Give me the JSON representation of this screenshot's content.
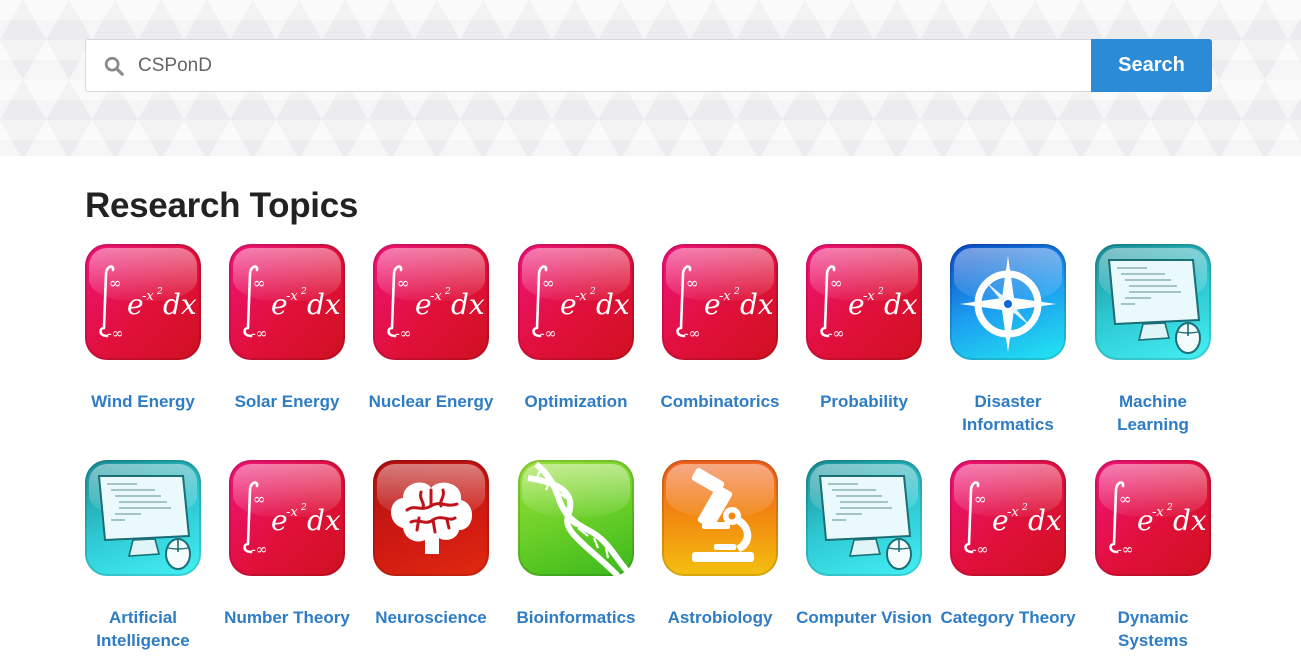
{
  "search": {
    "value": "",
    "placeholder": "CSPonD",
    "button_label": "Search",
    "icon": "search-icon"
  },
  "section_title": "Research Topics",
  "topics": [
    {
      "label": "Wind Energy",
      "icon": "math-integral-icon"
    },
    {
      "label": "Solar Energy",
      "icon": "math-integral-icon"
    },
    {
      "label": "Nuclear Energy",
      "icon": "math-integral-icon"
    },
    {
      "label": "Optimization",
      "icon": "math-integral-icon"
    },
    {
      "label": "Combinatorics",
      "icon": "math-integral-icon"
    },
    {
      "label": "Probability",
      "icon": "math-integral-icon"
    },
    {
      "label": "Disaster Informatics",
      "icon": "compass-icon"
    },
    {
      "label": "Machine Learning",
      "icon": "computer-icon"
    },
    {
      "label": "Artificial Intelligence",
      "icon": "computer-icon"
    },
    {
      "label": "Number Theory",
      "icon": "math-integral-icon"
    },
    {
      "label": "Neuroscience",
      "icon": "brain-icon"
    },
    {
      "label": "Bioinformatics",
      "icon": "dna-icon"
    },
    {
      "label": "Astrobiology",
      "icon": "microscope-icon"
    },
    {
      "label": "Computer Vision",
      "icon": "computer-icon"
    },
    {
      "label": "Category Theory",
      "icon": "math-integral-icon"
    },
    {
      "label": "Dynamic Systems",
      "icon": "math-integral-icon"
    }
  ],
  "colors": {
    "link": "#2e7cc4",
    "search_button": "#2b8bd6",
    "math_tile": "#e0103a",
    "compass_tile": "#1d9cf0",
    "computer_tile": "#2ec8d2",
    "brain_tile": "#d01a12",
    "dna_tile": "#6cd028",
    "microscope_tile": "#f28a10"
  }
}
